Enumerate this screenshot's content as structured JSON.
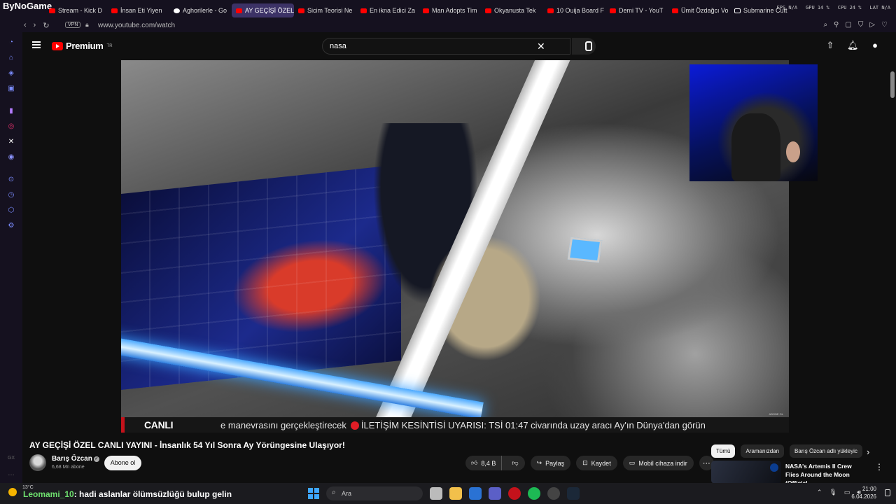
{
  "brand": "ByNoGame",
  "tabs": [
    {
      "label": "Stream - Kick D",
      "icon": "kick-icon",
      "active": false
    },
    {
      "label": "İnsan Eti Yiyen",
      "icon": "youtube-icon",
      "active": false
    },
    {
      "label": "Aghorilerle - Go",
      "icon": "google-icon",
      "active": false
    },
    {
      "label": "AY GEÇİŞİ ÖZEL CANLI YA",
      "icon": "youtube-icon",
      "active": true
    },
    {
      "label": "Sicim Teorisi Ne",
      "icon": "youtube-icon",
      "active": false
    },
    {
      "label": "En ikna Edici Za",
      "icon": "youtube-icon",
      "active": false
    },
    {
      "label": "Man Adopts Tim",
      "icon": "youtube-icon",
      "active": false
    },
    {
      "label": "Okyanusta Tek",
      "icon": "youtube-icon",
      "active": false
    },
    {
      "label": "10 Ouija Board F",
      "icon": "youtube-icon",
      "active": false
    },
    {
      "label": "Demi TV - YouT",
      "icon": "youtube-icon",
      "active": false
    },
    {
      "label": "Ümit Özdağcı Vo",
      "icon": "youtube-icon",
      "active": false
    },
    {
      "label": "Submarine Cutt",
      "icon": "x-icon",
      "active": false
    }
  ],
  "system_stats": [
    "FPS N/A",
    "GPU 14 %",
    "CPU 24 %",
    "LAT N/A"
  ],
  "address": {
    "vpn": "VPN",
    "url": "www.youtube.com/watch"
  },
  "youtube": {
    "logo_text": "Premium",
    "logo_region": "TR",
    "search_value": "nasa"
  },
  "video": {
    "watermark": "ABONE OL",
    "ticker_live": "CANLI",
    "ticker_text": "e manevrasını gerçekleştirecek",
    "ticker_alert": "İLETİŞİM KESİNTİSİ UYARISI: TSİ 01:47 civarında uzay aracı Ay'ın Dünya'dan görün"
  },
  "title": "AY GEÇİŞİ ÖZEL CANLI YAYINI - İnsanlık 54 Yıl Sonra Ay Yörüngesine Ulaşıyor!",
  "channel": {
    "name": "Barış Özcan",
    "subscribers": "6,68 Mn abone",
    "subscribe_label": "Abone ol"
  },
  "actions": {
    "likes": "8,4 B",
    "share": "Paylaş",
    "save": "Kaydet",
    "download": "Mobil cihaza indir"
  },
  "chips": [
    "Tümü",
    "Aramanızdan",
    "Barış Özcan adlı yükleyic"
  ],
  "recommendation": {
    "title": "NASA's Artemis II Crew Flies Around the Moon (Official ..."
  },
  "taskbar": {
    "weather": "13°C",
    "chat_user": "Leomami_10",
    "chat_message": ": hadi aslanlar ölümsüzlüğü bulup gelin",
    "search_placeholder": "Ara",
    "time": "21:00",
    "date": "6.04.2026"
  },
  "colors": {
    "accent": "#ff0000",
    "active_tab": "#3c3266",
    "ticker_red": "#c4121b",
    "chat_user": "#6ee06e"
  }
}
